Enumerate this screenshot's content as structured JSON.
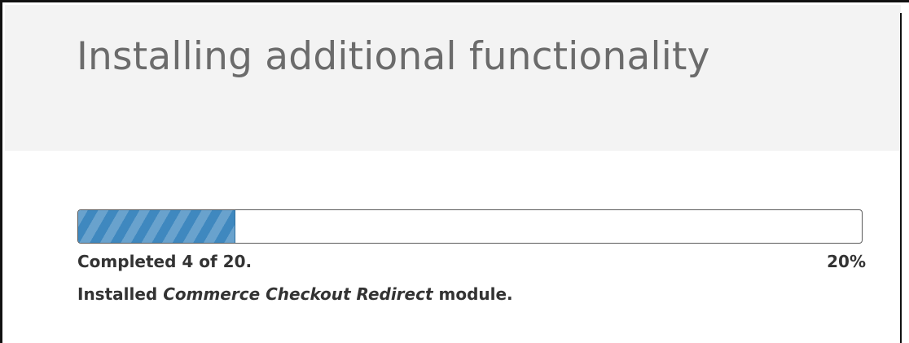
{
  "header": {
    "title": "Installing additional functionality"
  },
  "progress": {
    "status": "Completed 4 of 20.",
    "percent_label": "20%",
    "fraction": 0.2,
    "fill_color": "#3f88bf"
  },
  "message": {
    "prefix": "Installed",
    "module_name": "Commerce Checkout Redirect",
    "suffix": "module."
  }
}
